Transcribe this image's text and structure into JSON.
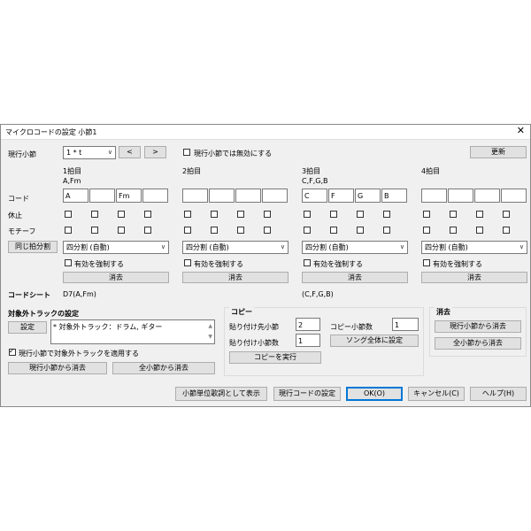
{
  "window": {
    "title": "マイクロコードの設定  小節1",
    "close_glyph": "✕"
  },
  "top": {
    "current_measure_label": "現行小節",
    "measure_value": "1 * t",
    "prev_btn": "<",
    "next_btn": ">",
    "disable_current_label": "現行小節では無効にする",
    "refresh_btn": "更新"
  },
  "row_labels": {
    "chord": "コード",
    "rest": "休止",
    "motif": "モチーフ",
    "same_split_btn": "同じ拍分割",
    "chord_sheet": "コードシート"
  },
  "beats": [
    {
      "label": "1拍目",
      "chords_summary": "A,Fm",
      "chords": [
        "A",
        "",
        "Fm",
        ""
      ],
      "split": "四分割 (自動)",
      "force": "有効を強制する",
      "clear": "消去",
      "sheet": "D7(A,Fm)"
    },
    {
      "label": "2拍目",
      "chords_summary": "",
      "chords": [
        "",
        "",
        "",
        ""
      ],
      "split": "四分割 (自動)",
      "force": "有効を強制する",
      "clear": "消去",
      "sheet": ""
    },
    {
      "label": "3拍目",
      "chords_summary": "C,F,G,B",
      "chords": [
        "C",
        "F",
        "G",
        "B"
      ],
      "split": "四分割 (自動)",
      "force": "有効を強制する",
      "clear": "消去",
      "sheet": "(C,F,G,B)"
    },
    {
      "label": "4拍目",
      "chords_summary": "",
      "chords": [
        "",
        "",
        "",
        ""
      ],
      "split": "四分割 (自動)",
      "force": "有効を強制する",
      "clear": "消去",
      "sheet": ""
    }
  ],
  "excluded": {
    "title": "対象外トラックの設定",
    "settings_btn": "設定",
    "list_text": "* 対象外トラック：ドラム, ギター",
    "apply_label": "現行小節で対象外トラックを適用する",
    "clear_current_btn": "現行小節から消去",
    "clear_all_btn": "全小節から消去"
  },
  "copy": {
    "title": "コピー",
    "paste_dest_label": "貼り付け先小節",
    "paste_dest_value": "2",
    "paste_count_label": "貼り付け小節数",
    "paste_count_value": "1",
    "copy_count_label": "コピー小節数",
    "copy_count_value": "1",
    "whole_song_btn": "ソング全体に設定",
    "run_btn": "コピーを実行"
  },
  "erase": {
    "title": "消去",
    "current_btn": "現行小節から消去",
    "all_btn": "全小節から消去"
  },
  "footer": {
    "show_lyrics_btn": "小節単位歌詞として表示",
    "current_chord_btn": "現行コードの設定",
    "ok_btn": "OK(O)",
    "cancel_btn": "キャンセル(C)",
    "help_btn": "ヘルプ(H)"
  }
}
